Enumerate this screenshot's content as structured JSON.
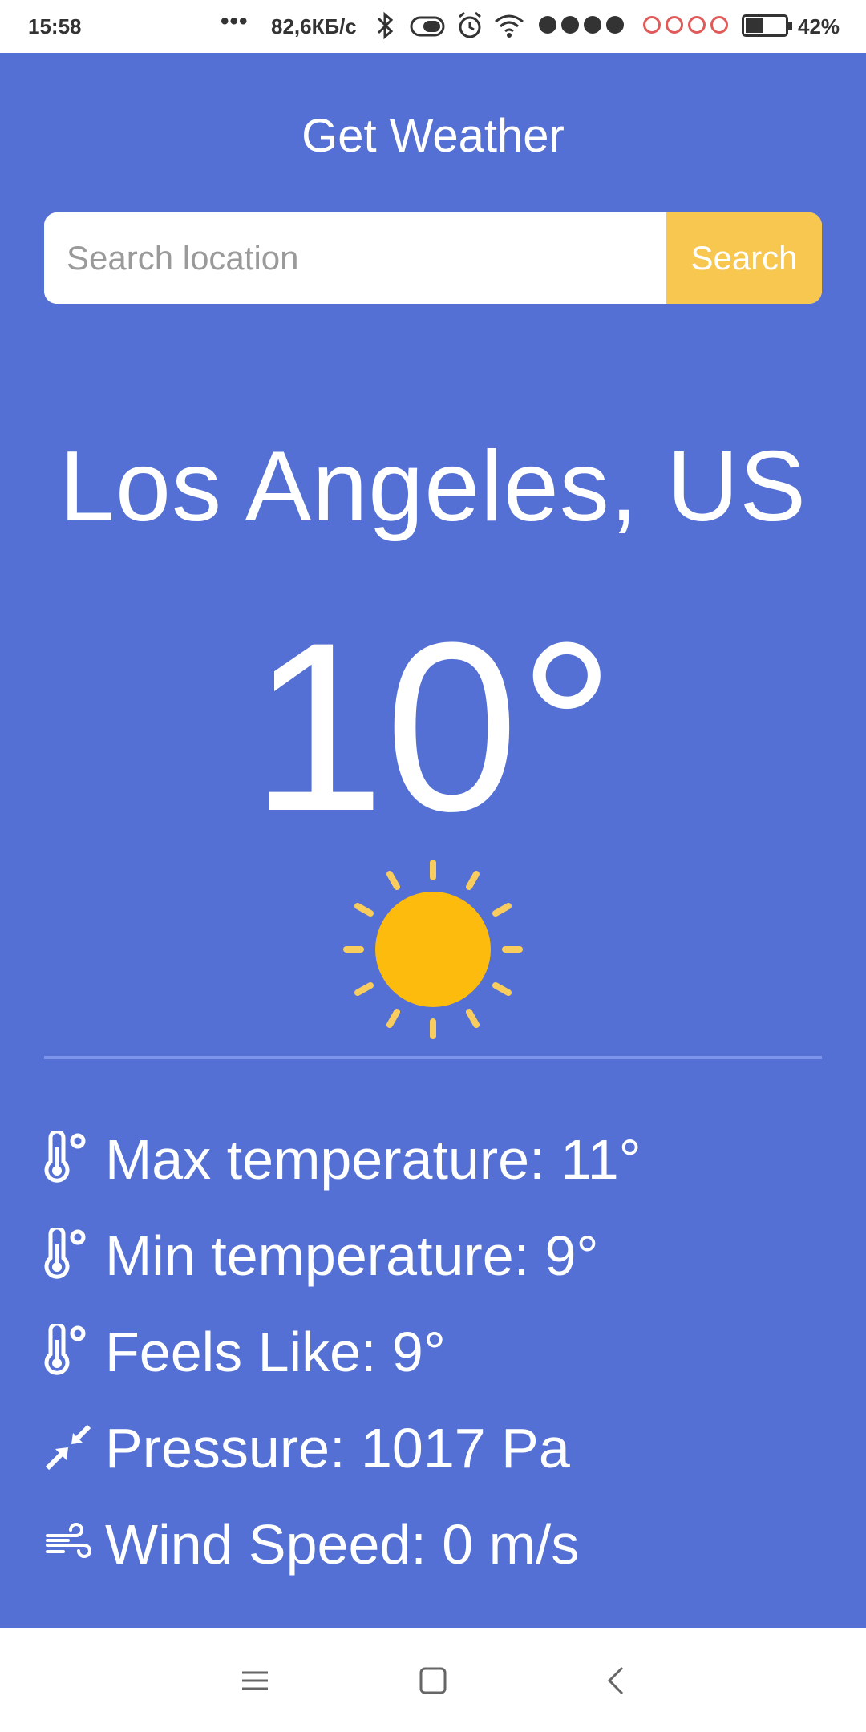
{
  "status_bar": {
    "time": "15:58",
    "more": "•••",
    "network_speed": "82,6КБ/с",
    "battery_percent": "42%",
    "battery_level": 0.42,
    "icons": [
      "bluetooth-icon",
      "toggle-icon",
      "alarm-icon",
      "wifi-icon",
      "signal-sim1-icon",
      "signal-sim2-icon",
      "battery-icon"
    ]
  },
  "app": {
    "title": "Get Weather",
    "colors": {
      "background": "#5470d4",
      "search_button": "#f8c74f",
      "sun": "#fdbb0e",
      "sun_rays": "#f8cd5d"
    }
  },
  "search": {
    "placeholder": "Search location",
    "value": "",
    "button_label": "Search"
  },
  "weather": {
    "location": "Los Angeles, US",
    "temperature": "10°",
    "condition_icon": "sun-icon"
  },
  "details": [
    {
      "icon": "thermometer-icon",
      "text": "Max temperature: 11°"
    },
    {
      "icon": "thermometer-icon",
      "text": "Min temperature: 9°"
    },
    {
      "icon": "thermometer-icon",
      "text": "Feels Like: 9°"
    },
    {
      "icon": "pressure-arrows-icon",
      "text": "Pressure: 1017 Pa"
    },
    {
      "icon": "wind-icon",
      "text": "Wind Speed: 0 m/s"
    }
  ],
  "nav_bar": {
    "icons": [
      "menu-icon",
      "home-icon",
      "back-icon"
    ]
  }
}
